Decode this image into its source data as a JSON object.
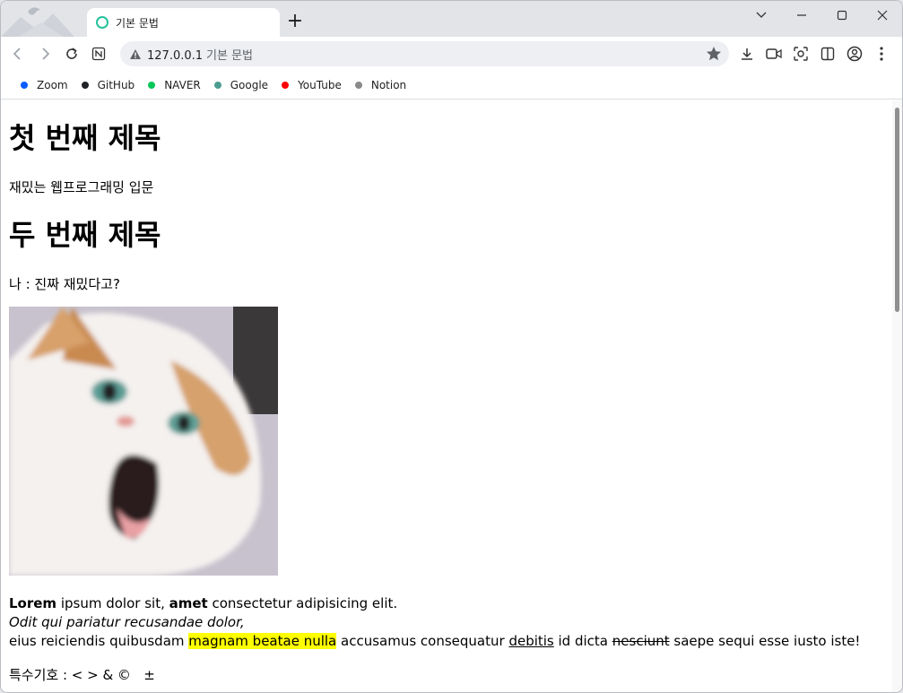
{
  "browser": {
    "tab_title": "기본 문법",
    "new_tab": "+",
    "url_host": "127.0.0.1",
    "url_title": "기본 문법",
    "colors": {
      "tab_favicon": "#24c29b"
    }
  },
  "bookmarks": [
    {
      "label": "Zoom",
      "color": "#0b5cff"
    },
    {
      "label": "GitHub",
      "color": "#1f2328"
    },
    {
      "label": "NAVER",
      "color": "#03c75a"
    },
    {
      "label": "Google",
      "color": "#4c9d8f"
    },
    {
      "label": "YouTube",
      "color": "#ff0000"
    },
    {
      "label": "Notion",
      "color": "#8a8a8a"
    }
  ],
  "content": {
    "heading1": "첫 번째 제목",
    "para1": "재밌는 웹프로그래밍 입문",
    "heading2": "두 번째 제목",
    "para2": "나 : 진짜 재밌다고?",
    "lorem": {
      "b1": "Lorem",
      "t1": " ipsum dolor sit, ",
      "b2": "amet",
      "t2": " consectetur adipisicing elit.",
      "italic": "Odit qui pariatur recusandae dolor,",
      "t3": "eius reiciendis quibusdam ",
      "mark": "magnam beatae nulla",
      "t4": " accusamus consequatur ",
      "underline": "debitis",
      "t5": " id dicta ",
      "strike": "nesciunt",
      "t6": " saepe sequi esse iusto iste!"
    },
    "special": "특수기호 : < > & ©   ±"
  }
}
